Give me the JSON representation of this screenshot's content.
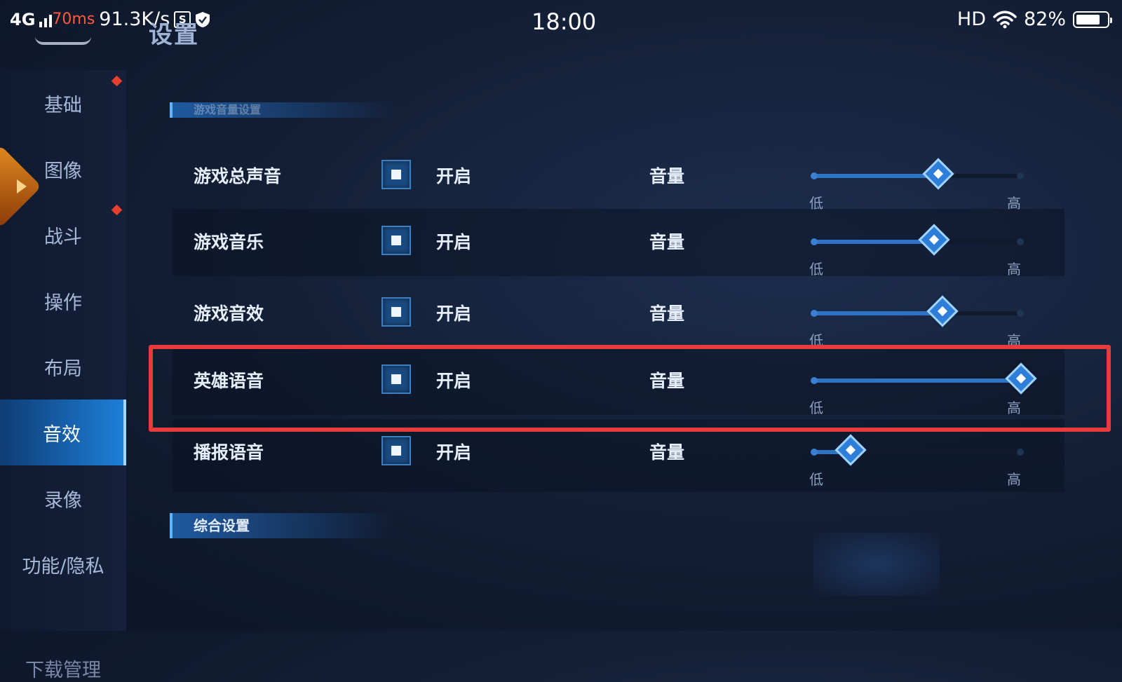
{
  "status_bar": {
    "network": "4G",
    "ping": "70ms",
    "speed": "91.3K/s",
    "time": "18:00",
    "hd": "HD",
    "battery": "82%",
    "battery_level": 0.82
  },
  "page": {
    "title": "设置"
  },
  "sidebar": {
    "items": [
      {
        "label": "基础",
        "active": false,
        "dot": false
      },
      {
        "label": "图像",
        "active": false,
        "dot": false
      },
      {
        "label": "战斗",
        "active": false,
        "dot": false
      },
      {
        "label": "操作",
        "active": false,
        "dot": false
      },
      {
        "label": "布局",
        "active": false,
        "dot": false
      },
      {
        "label": "音效",
        "active": true,
        "dot": false
      },
      {
        "label": "录像",
        "active": false,
        "dot": false
      },
      {
        "label": "功能/隐私",
        "active": false,
        "dot": false
      },
      {
        "label": "下载管理",
        "active": false,
        "dot": false
      }
    ]
  },
  "sections": {
    "sound": "游戏音量设置",
    "general": "综合设置"
  },
  "rows": [
    {
      "label": "游戏总声音",
      "toggle_text": "开启",
      "volume_label": "音量",
      "low": "低",
      "high": "高",
      "level": 0.6
    },
    {
      "label": "游戏音乐",
      "toggle_text": "开启",
      "volume_label": "音量",
      "low": "低",
      "high": "高",
      "level": 0.58
    },
    {
      "label": "游戏音效",
      "toggle_text": "开启",
      "volume_label": "音量",
      "low": "低",
      "high": "高",
      "level": 0.62
    },
    {
      "label": "英雄语音",
      "toggle_text": "开启",
      "volume_label": "音量",
      "low": "低",
      "high": "高",
      "level": 1.0
    },
    {
      "label": "播报语音",
      "toggle_text": "开启",
      "volume_label": "音量",
      "low": "低",
      "high": "高",
      "level": 0.18
    }
  ],
  "colors": {
    "accent": "#2d7ed8",
    "highlight": "#e63c3c",
    "ping": "#ff5a3c"
  }
}
